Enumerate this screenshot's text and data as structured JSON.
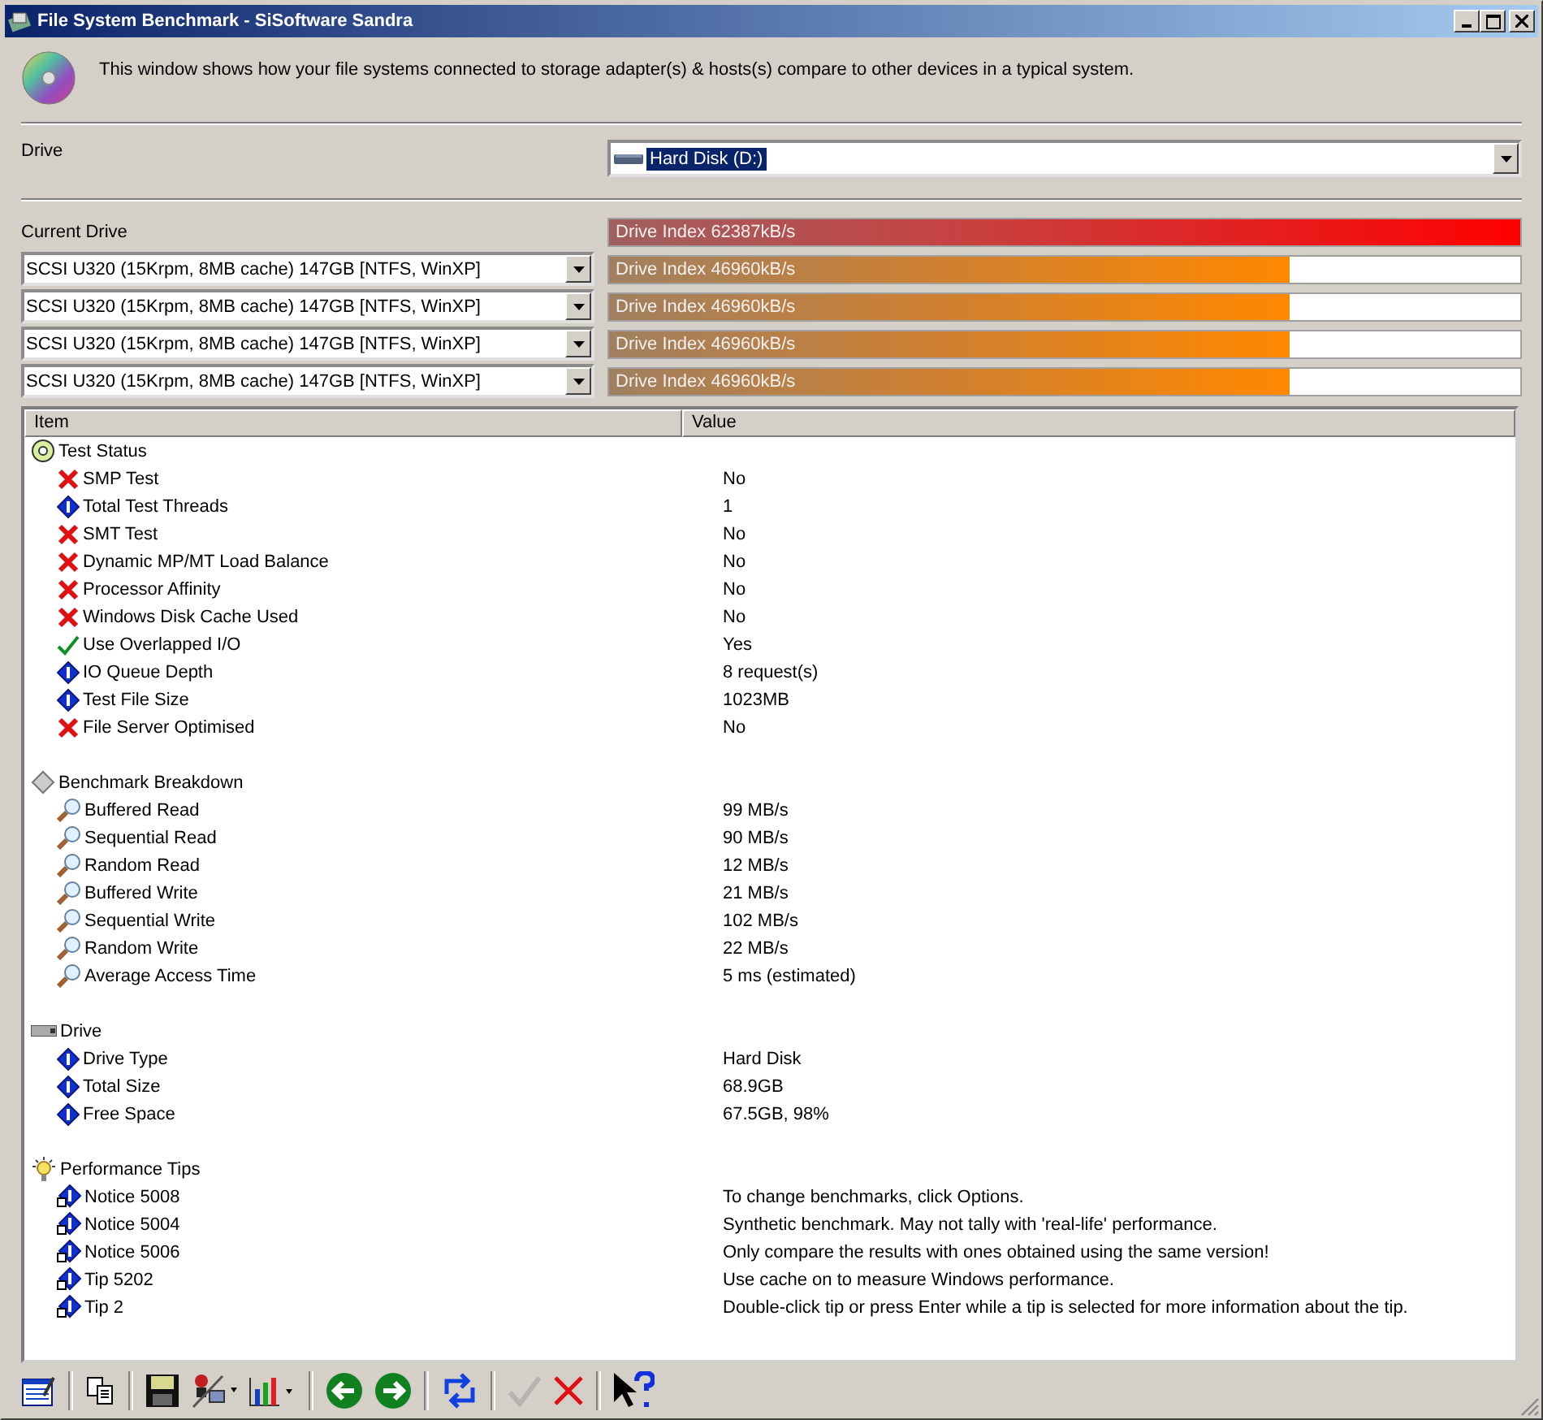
{
  "window": {
    "title": "File System Benchmark - SiSoftware Sandra"
  },
  "description": "This window shows how your file systems connected to storage adapter(s) & hosts(s) compare to other devices in a typical system.",
  "drive": {
    "label": "Drive",
    "value": "Hard Disk (D:)"
  },
  "current_drive": {
    "label": "Current Drive",
    "bar": {
      "text": "Drive Index 62387kB/s",
      "level": 1,
      "kind": "current"
    }
  },
  "comparisons": [
    {
      "device": "SCSI U320 (15Krpm, 8MB cache) 147GB [NTFS, WinXP]",
      "bar": {
        "text": "Drive Index 46960kB/s",
        "level": 0.747,
        "kind": "reference"
      }
    },
    {
      "device": "SCSI U320 (15Krpm, 8MB cache) 147GB [NTFS, WinXP]",
      "bar": {
        "text": "Drive Index 46960kB/s",
        "level": 0.747,
        "kind": "reference"
      }
    },
    {
      "device": "SCSI U320 (15Krpm, 8MB cache) 147GB [NTFS, WinXP]",
      "bar": {
        "text": "Drive Index 46960kB/s",
        "level": 0.747,
        "kind": "reference"
      }
    },
    {
      "device": "SCSI U320 (15Krpm, 8MB cache) 147GB [NTFS, WinXP]",
      "bar": {
        "text": "Drive Index 46960kB/s",
        "level": 0.747,
        "kind": "reference"
      }
    }
  ],
  "table": {
    "columns": [
      "Item",
      "Value"
    ],
    "groups": [
      {
        "label": "Test Status",
        "kind": "status",
        "children": [
          {
            "item": "SMP Test",
            "value": "No",
            "kind": "fail"
          },
          {
            "item": "Total Test Threads",
            "value": "1",
            "kind": "info"
          },
          {
            "item": "SMT Test",
            "value": "No",
            "kind": "fail"
          },
          {
            "item": "Dynamic MP/MT Load Balance",
            "value": "No",
            "kind": "fail"
          },
          {
            "item": "Processor Affinity",
            "value": "No",
            "kind": "fail"
          },
          {
            "item": "Windows Disk Cache Used",
            "value": "No",
            "kind": "fail"
          },
          {
            "item": "Use Overlapped I/O",
            "value": "Yes",
            "kind": "pass"
          },
          {
            "item": "IO Queue Depth",
            "value": "8 request(s)",
            "kind": "info"
          },
          {
            "item": "Test File Size",
            "value": "1023MB",
            "kind": "info"
          },
          {
            "item": "File Server Optimised",
            "value": "No",
            "kind": "fail"
          }
        ]
      },
      {
        "label": "Benchmark Breakdown",
        "kind": "benchmark",
        "children": [
          {
            "item": "Buffered Read",
            "value": "99 MB/s",
            "kind": "measure"
          },
          {
            "item": "Sequential Read",
            "value": "90 MB/s",
            "kind": "measure"
          },
          {
            "item": "Random Read",
            "value": "12 MB/s",
            "kind": "measure"
          },
          {
            "item": "Buffered Write",
            "value": "21 MB/s",
            "kind": "measure"
          },
          {
            "item": "Sequential Write",
            "value": "102 MB/s",
            "kind": "measure"
          },
          {
            "item": "Random Write",
            "value": "22 MB/s",
            "kind": "measure"
          },
          {
            "item": "Average Access Time",
            "value": "5 ms (estimated)",
            "kind": "measure"
          }
        ]
      },
      {
        "label": "Drive",
        "kind": "drive",
        "children": [
          {
            "item": "Drive Type",
            "value": "Hard Disk",
            "kind": "info"
          },
          {
            "item": "Total Size",
            "value": "68.9GB",
            "kind": "info"
          },
          {
            "item": "Free Space",
            "value": "67.5GB, 98%",
            "kind": "info"
          }
        ]
      },
      {
        "label": "Performance Tips",
        "kind": "tips",
        "children": [
          {
            "item": "Notice 5008",
            "value": "To change benchmarks, click Options.",
            "kind": "tip"
          },
          {
            "item": "Notice 5004",
            "value": "Synthetic benchmark. May not tally with 'real-life' performance.",
            "kind": "tip"
          },
          {
            "item": "Notice 5006",
            "value": "Only compare the results with ones obtained using the same version!",
            "kind": "tip"
          },
          {
            "item": "Tip 5202",
            "value": "Use cache on to measure Windows performance.",
            "kind": "tip"
          },
          {
            "item": "Tip 2",
            "value": "Double-click tip or press Enter while a tip is selected for more information about the tip.",
            "kind": "tip"
          }
        ]
      }
    ]
  },
  "toolbar": [
    [
      {
        "kind": "report",
        "disabled": false
      }
    ],
    [
      {
        "kind": "copy",
        "disabled": false
      }
    ],
    [
      {
        "kind": "save",
        "disabled": false
      },
      {
        "kind": "options",
        "disabled": false
      },
      {
        "kind": "chart",
        "disabled": false
      }
    ],
    [
      {
        "kind": "back",
        "disabled": false
      },
      {
        "kind": "forward",
        "disabled": false
      }
    ],
    [
      {
        "kind": "refresh",
        "disabled": false
      }
    ],
    [
      {
        "kind": "ok",
        "disabled": true
      },
      {
        "kind": "cancel",
        "disabled": false
      }
    ],
    [
      {
        "kind": "help",
        "disabled": false
      }
    ]
  ]
}
